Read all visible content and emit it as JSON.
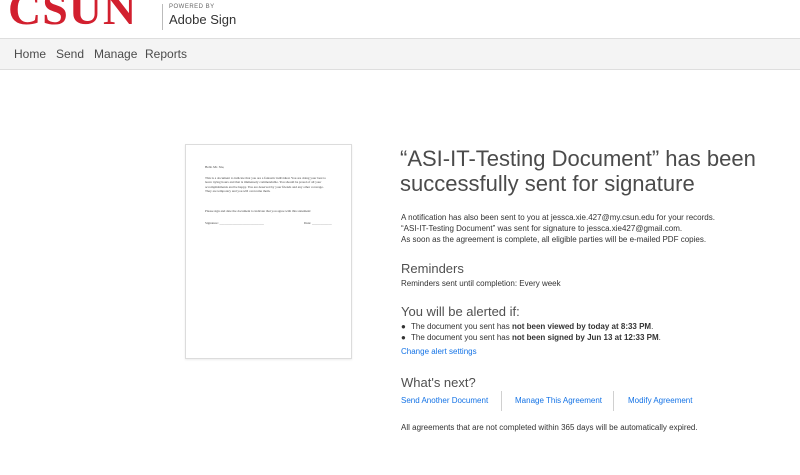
{
  "header": {
    "logo": "CSUN",
    "powered_by": "POWERED BY",
    "product": "Adobe Sign"
  },
  "nav": {
    "items": [
      "Home",
      "Send",
      "Manage",
      "Reports"
    ]
  },
  "doc_preview": {
    "greeting": "Hello Mr. Xie,",
    "body": [
      "This is a document to indicate that you are a fantastic individual. You are doing your best to",
      "leave trying hours and that is immensely commendable. You should be proud of all your",
      "accomplishments and be happy. You are deserved by your friends and any other coverage.",
      "They are temporary and you will overcome them."
    ],
    "sign_prompt": "Please sign and date the document to indicate that you agree with this statement:",
    "signature_label": "Signature: ___________________________",
    "date_label": "Date: ____________"
  },
  "main": {
    "title": "“ASI-IT-Testing Document” has been successfully sent for signature",
    "notices": [
      "A notification has also been sent to you at jessca.xie.427@my.csun.edu for your records.",
      "“ASI-IT-Testing Document” was sent for signature to jessca.xie427@gmail.com.",
      "As soon as the agreement is complete, all eligible parties will be e-mailed PDF copies."
    ],
    "reminders": {
      "heading": "Reminders",
      "text": "Reminders sent until completion: Every week"
    },
    "alerts": {
      "heading": "You will be alerted if:",
      "items": [
        {
          "pre": "The document you sent has ",
          "bold": "not been viewed by today at 8:33 PM",
          "post": "."
        },
        {
          "pre": "The document you sent has ",
          "bold": "not been signed by Jun 13 at 12:33 PM",
          "post": "."
        }
      ],
      "change_link": "Change alert settings"
    },
    "next": {
      "heading": "What's next?",
      "actions": [
        "Send Another Document",
        "Manage This Agreement",
        "Modify Agreement"
      ]
    },
    "footer_note": "All agreements that are not completed within 365 days will be automatically expired."
  },
  "colors": {
    "brand": "#d2202f",
    "link": "#1473e6"
  }
}
